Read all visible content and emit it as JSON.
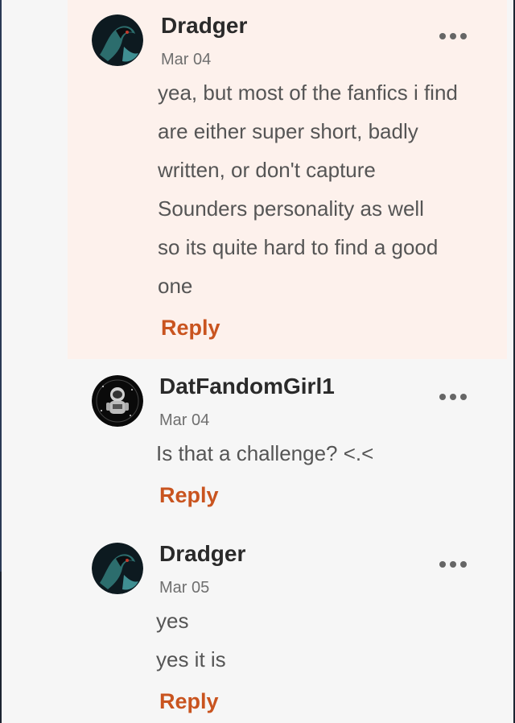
{
  "comments": [
    {
      "username": "Dradger",
      "date": "Mar 04",
      "lines": [
        "yea, but most of the fanfics i find",
        "are either super short, badly",
        "written, or don't capture",
        "Sounders personality as well",
        "so its quite hard to find a good",
        "one"
      ],
      "reply_label": "Reply",
      "highlighted": true
    },
    {
      "username": "DatFandomGirl1",
      "date": "Mar 04",
      "lines": [
        "Is that a challenge? <.<"
      ],
      "reply_label": "Reply",
      "highlighted": false
    },
    {
      "username": "Dradger",
      "date": "Mar 05",
      "lines": [
        "yes",
        "yes it is"
      ],
      "reply_label": "Reply",
      "highlighted": false
    }
  ],
  "colors": {
    "reply": "#c9541f",
    "highlight_bg": "#fdf1ec",
    "page_bg": "#f6f6f6"
  },
  "icons": {
    "more": "more-options-icon",
    "avatar_dradger": "dark-creature-avatar",
    "avatar_datfandomgirl": "astronaut-avatar"
  }
}
